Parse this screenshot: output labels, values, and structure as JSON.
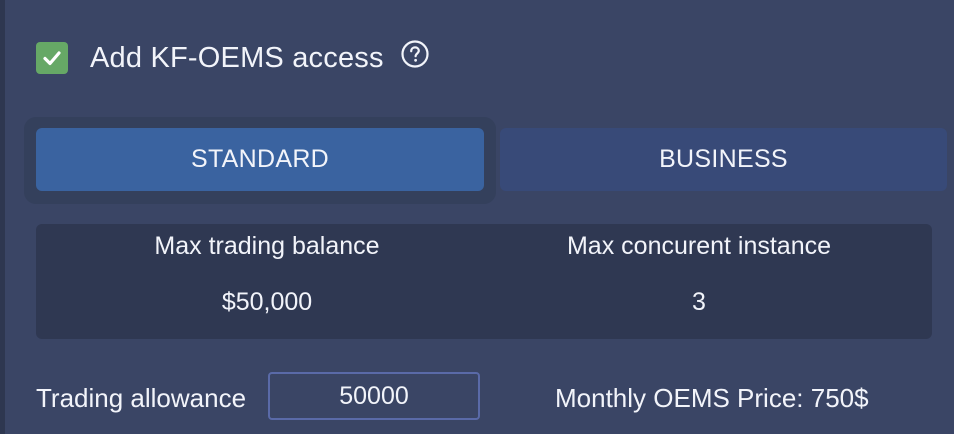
{
  "oems_access": {
    "label": "Add KF-OEMS access",
    "checked": true,
    "help_icon": "question-circle-icon",
    "check_icon": "checkmark-icon"
  },
  "plans": {
    "selected": "STANDARD",
    "standard_label": "STANDARD",
    "business_label": "BUSINESS"
  },
  "limits": {
    "max_balance_label": "Max trading balance",
    "max_balance_value": "$50,000",
    "max_instances_label": "Max concurent instance",
    "max_instances_value": "3"
  },
  "allowance": {
    "label": "Trading allowance",
    "value": "50000"
  },
  "pricing": {
    "monthly_text": "Monthly OEMS Price: 750$"
  },
  "colors": {
    "background": "#3a4565",
    "selected_plan": "#3a63a0",
    "unselected_plan": "#384a78",
    "checkbox": "#66a866",
    "panel": "#2f3852"
  }
}
